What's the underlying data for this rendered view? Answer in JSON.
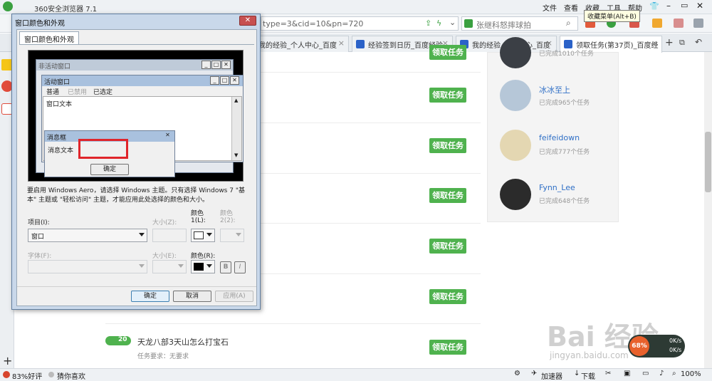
{
  "browser": {
    "title": "360安全浏览器 7.1",
    "menu": [
      "文件",
      "查看",
      "收藏",
      "工具",
      "帮助"
    ],
    "tooltip": "收藏菜单(Alt+B)",
    "address_fragment": "type=3&cid=10&pn=720",
    "search_text": "张继科怒摔球拍"
  },
  "tabs": [
    {
      "label": "我的经验_个人中心_百度"
    },
    {
      "label": "经验签到日历_百度经验"
    },
    {
      "label": "我的经验_个人中心_百度"
    },
    {
      "label": "领取任务(第37页)_百度经"
    }
  ],
  "page": {
    "claim_label": "领取任务",
    "task": {
      "badge": "20",
      "title": "天龙八部3天山怎么打宝石",
      "req": "任务要求：无要求"
    }
  },
  "users": [
    {
      "name": "",
      "count": "已完成1010个任务"
    },
    {
      "name": "冰冰至上",
      "count": "已完成965个任务"
    },
    {
      "name": "feifeidown",
      "count": "已完成777个任务"
    },
    {
      "name": "Fynn_Lee",
      "count": "已完成648个任务"
    }
  ],
  "dialog": {
    "title": "窗口颜色和外观",
    "tab": "窗口颜色和外观",
    "preview": {
      "inactive": "非活动窗口",
      "active": "活动窗口",
      "menu_normal": "普通",
      "menu_disabled": "已禁用",
      "menu_selected": "已选定",
      "window_text": "窗口文本",
      "msgbox_title": "消息框",
      "msgbox_text": "消息文本",
      "ok": "确定"
    },
    "description": "要启用 Windows Aero，请选择 Windows 主题。只有选择 Windows 7 \"基本\" 主题或 \"轻松访问\" 主题，才能应用此处选择的颜色和大小。",
    "item_label": "项目(I):",
    "item_value": "窗口",
    "size_label": "大小(Z):",
    "color1_label": "颜色",
    "color1_sub": "1(L):",
    "color2_label": "颜色",
    "color2_sub": "2(2):",
    "font_label": "字体(F):",
    "size2_label": "大小(E):",
    "color_label": "颜色(R):",
    "bold": "B",
    "italic": "I",
    "ok": "确定",
    "cancel": "取消",
    "apply": "应用(A)"
  },
  "status": {
    "rating": "83%好评",
    "guess": "猜你喜欢",
    "accelerator": "加速器",
    "download": "下载",
    "zoom": "100%"
  },
  "float": {
    "percent": "68%",
    "up": "0K/s",
    "down": "0K/s"
  },
  "watermark": {
    "main": "Bai 经验",
    "sub": "jingyan.baidu.com"
  }
}
